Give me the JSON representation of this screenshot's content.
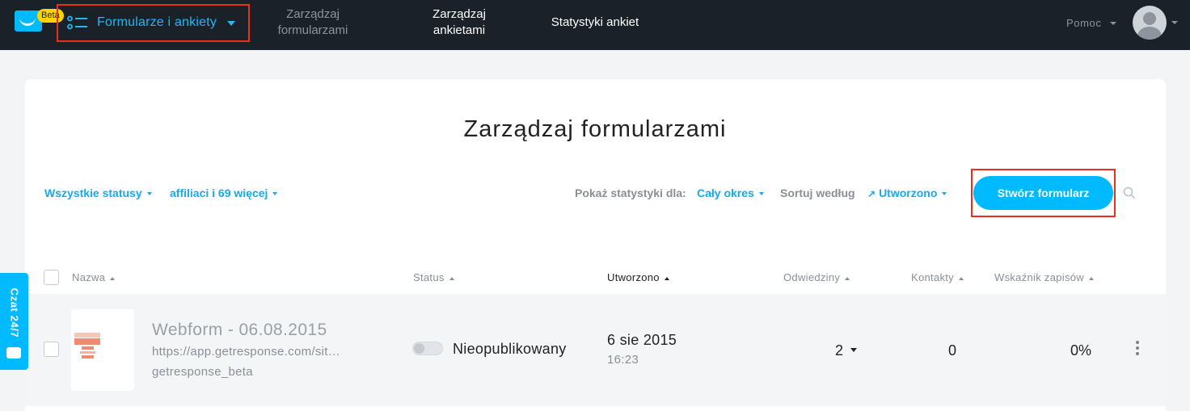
{
  "topbar": {
    "beta_badge": "Beta",
    "module_title": "Formularze i ankiety",
    "nav": [
      {
        "line1": "Zarządzaj",
        "line2": "formularzami"
      },
      {
        "line1": "Zarządzaj",
        "line2": "ankietami"
      },
      {
        "line1": "Statystyki ankiet",
        "line2": ""
      }
    ],
    "help": "Pomoc"
  },
  "page_title": "Zarządzaj formularzami",
  "filters": {
    "status": "Wszystkie statusy",
    "campaigns": "affiliaci i 69 więcej",
    "stats_label": "Pokaż statystyki dla:",
    "stats_value": "Cały okres",
    "sort_label": "Sortuj według",
    "sort_value": "Utworzono"
  },
  "create_button": "Stwórz formularz",
  "table": {
    "headers": {
      "name": "Nazwa",
      "status": "Status",
      "created": "Utworzono",
      "visits": "Odwiedziny",
      "contacts": "Kontakty",
      "signup_rate": "Wskaźnik zapisów"
    },
    "rows": [
      {
        "name": "Webform - 06.08.2015",
        "url": "https://app.getresponse.com/sit…",
        "campaign": "getresponse_beta",
        "status": "Nieopublikowany",
        "date": "6 sie 2015",
        "time": "16:23",
        "visits": "2",
        "contacts": "0",
        "signup_rate": "0%"
      }
    ]
  },
  "chat_tab": "Czat 24/7",
  "colors": {
    "topbar": "#1b2129",
    "accent": "#00baff",
    "link": "#19a9e6",
    "highlight": "#e8301c"
  }
}
